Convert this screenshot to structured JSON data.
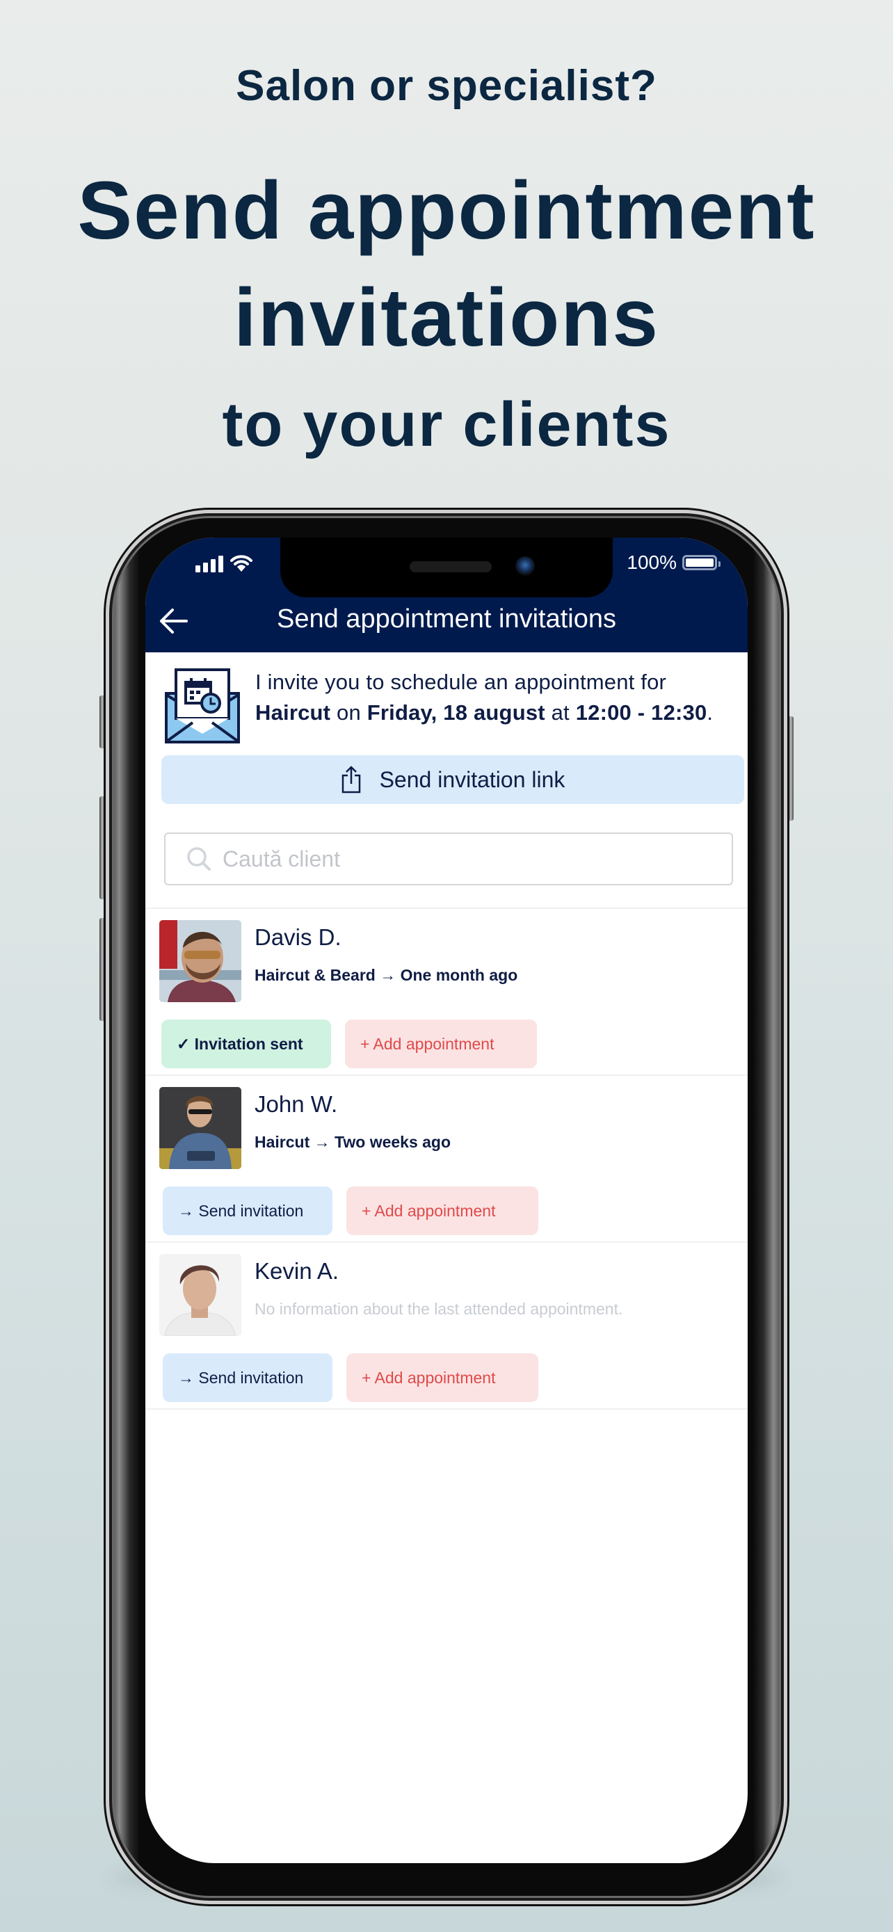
{
  "hero": {
    "subtitle": "Salon or specialist?",
    "title_line1": "Send appointment",
    "title_line2": "invitations",
    "tagline": "to your clients"
  },
  "status_bar": {
    "battery_text": "100%",
    "battery_level_percent": 100
  },
  "header": {
    "title": "Send appointment invitations",
    "back_icon": "arrow-left-icon"
  },
  "invitation": {
    "icon": "envelope-calendar-icon",
    "intro": "I invite you to schedule an appointment for",
    "service": "Haircut",
    "on": " on ",
    "date": "Friday, 18 august",
    "at": " at ",
    "time": "12:00 - 12:30",
    "end": "."
  },
  "link_button": {
    "label": "Send invitation link",
    "icon": "share-icon"
  },
  "search": {
    "placeholder": "Caută client",
    "value": ""
  },
  "clients": [
    {
      "name": "Davis D.",
      "meta": "Haircut & Beard → One month ago",
      "primary_action": "✓ Invitation sent",
      "primary_state": "sent",
      "secondary_action": "+ Add appointment"
    },
    {
      "name": "John W.",
      "meta": "Haircut → Two weeks ago",
      "primary_action": "→ Send invitation",
      "primary_state": "not-sent",
      "secondary_action": "+ Add appointment"
    },
    {
      "name": "Kevin A.",
      "meta": "No information about the last attended appointment.",
      "primary_action": "→ Send invitation",
      "primary_state": "not-sent",
      "secondary_action": "+ Add appointment"
    }
  ],
  "colors": {
    "brand_navy": "#001a4d",
    "text_navy": "#0f1d45",
    "hero_text": "#0b2741",
    "light_blue": "#d9eafb",
    "sent_green": "#d0f2e1",
    "add_pink": "#fbe3e3",
    "add_red": "#e04a4a"
  }
}
